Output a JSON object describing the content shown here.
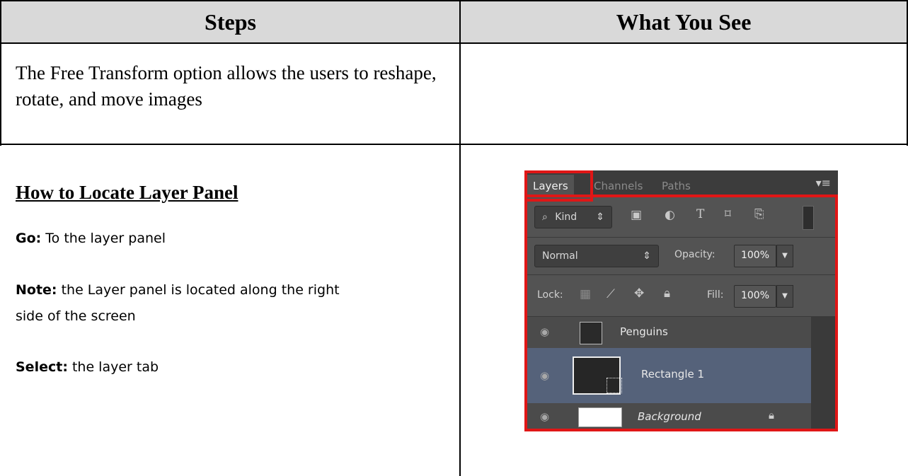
{
  "table": {
    "header_steps": "Steps",
    "header_what": "What You See",
    "intro": "The Free Transform option allows the users to reshape, rotate, and move images",
    "section_title": "How to Locate Layer Panel",
    "go_label": "Go:",
    "go_text": " To the layer panel",
    "note_label": "Note:",
    "note_text_1": " the Layer panel is located along the right",
    "note_text_2": "side of the screen",
    "select_label": "Select:",
    "select_text": "  the layer tab"
  },
  "panel": {
    "tabs": [
      "Layers",
      "Channels",
      "Paths"
    ],
    "filter_kind": "Kind",
    "blend_mode": "Normal",
    "opacity_label": "Opacity:",
    "opacity_value": "100%",
    "lock_label": "Lock:",
    "fill_label": "Fill:",
    "fill_value": "100%",
    "layers": [
      {
        "name": "Penguins"
      },
      {
        "name": "Rectangle 1"
      },
      {
        "name": "Background"
      }
    ],
    "colors": {
      "highlight": "#e01616",
      "panel_bg": "#535353",
      "selected_layer": "#55627a"
    }
  }
}
